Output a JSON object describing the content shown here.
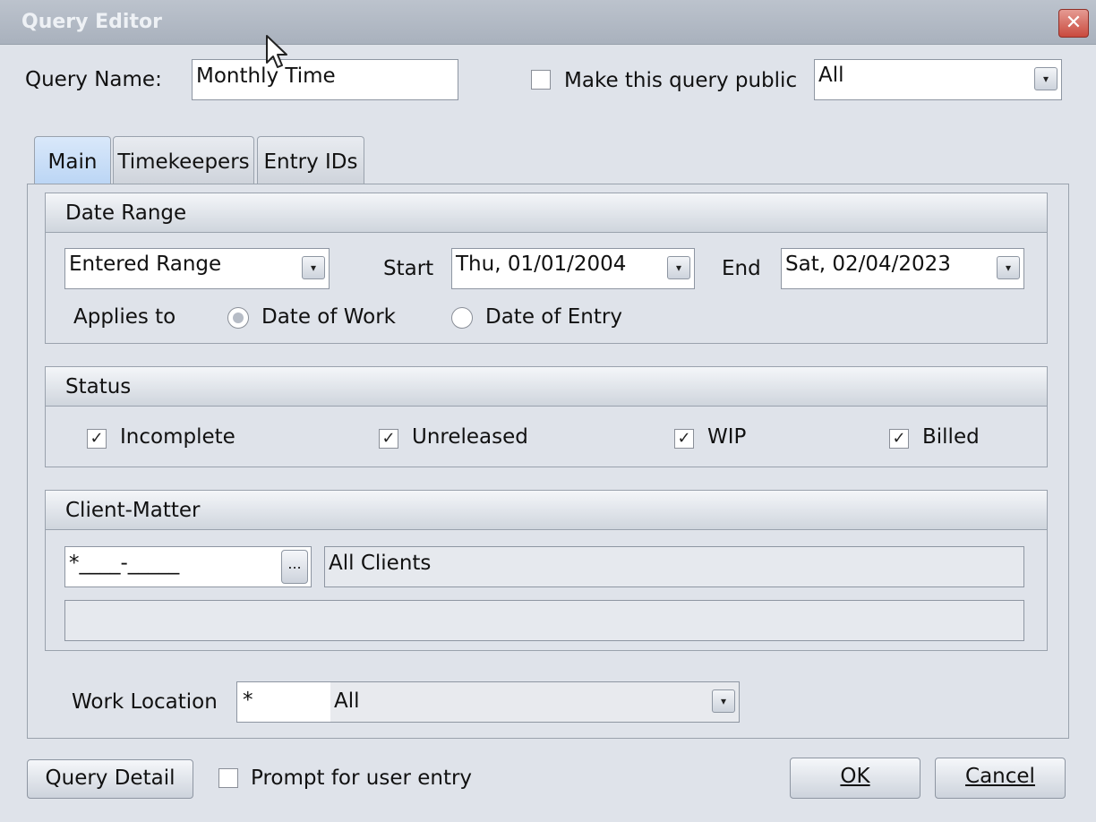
{
  "window": {
    "title": "Query Editor",
    "close_glyph": "✕"
  },
  "header": {
    "query_name_label": "Query Name:",
    "query_name_value": "Monthly Time",
    "public_label": "Make this query public",
    "public_checked": false,
    "public_scope_value": "All"
  },
  "tabs": [
    {
      "label": "Main",
      "active": true
    },
    {
      "label": "Timekeepers",
      "active": false
    },
    {
      "label": "Entry IDs",
      "active": false
    }
  ],
  "date_range": {
    "heading": "Date Range",
    "range_type": "Entered Range",
    "start_label": "Start",
    "start_value": "Thu, 01/01/2004",
    "end_label": "End",
    "end_value": "Sat, 02/04/2023",
    "applies_label": "Applies to",
    "option_work": "Date of Work",
    "option_entry": "Date of Entry",
    "selected": "Date of Work"
  },
  "status": {
    "heading": "Status",
    "items": [
      {
        "label": "Incomplete",
        "checked": true
      },
      {
        "label": "Unreleased",
        "checked": true
      },
      {
        "label": "WIP",
        "checked": true
      },
      {
        "label": "Billed",
        "checked": true
      }
    ]
  },
  "client_matter": {
    "heading": "Client-Matter",
    "mask_value": "*____-_____",
    "browse_label": "...",
    "description": "All Clients",
    "extra_value": ""
  },
  "work_location": {
    "label": "Work Location",
    "code_value": "*",
    "name_value": "All"
  },
  "footer": {
    "query_detail_label": "Query Detail",
    "prompt_label": "Prompt for user entry",
    "prompt_checked": false,
    "ok_label": "OK",
    "cancel_label": "Cancel"
  },
  "icons": {
    "check_glyph": "✓",
    "dropdown_glyph": "▾"
  }
}
